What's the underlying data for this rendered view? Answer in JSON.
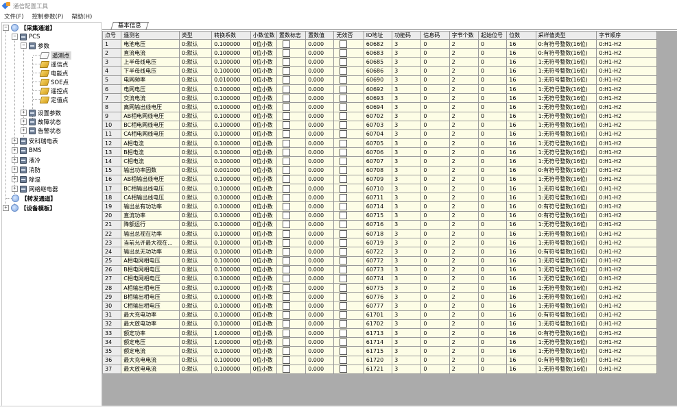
{
  "window": {
    "title": "通信配置工具"
  },
  "menu": [
    "文件(F)",
    "控制参数(P)",
    "帮助(H)"
  ],
  "tree": {
    "acq_channel": "【采集通道】",
    "pcs": "PCS",
    "params": "参数",
    "leaves": [
      "遥测点",
      "遥信点",
      "电能点",
      "SOE点",
      "遥控点",
      "定值点"
    ],
    "pcs_groups": [
      "设置参数",
      "故障状态",
      "告警状态"
    ],
    "devices": [
      "安科瑞电表",
      "BMS",
      "液冷",
      "消防",
      "除湿",
      "网络继电器"
    ],
    "fwd_channel": "【转发通道】",
    "dev_template": "【设备模板】"
  },
  "tab": {
    "label": "基本信息"
  },
  "columns": [
    "点号",
    "遥测名",
    "类型",
    "转换系数",
    "小数位数",
    "置数标志",
    "置数值",
    "无效否",
    "IO地址",
    "功能码",
    "信息码",
    "字节个数",
    "起始位号",
    "位数",
    "采样值类型",
    "字节顺序"
  ],
  "rows": [
    [
      "1",
      "电池电压",
      "0:默认",
      "0.100000",
      "0位小数",
      "",
      "0.000",
      "",
      "60682",
      "3",
      "0",
      "2",
      "0",
      "16",
      "0:有符号整数(16位)",
      "0:H1-H2"
    ],
    [
      "2",
      "直流电流",
      "0:默认",
      "0.100000",
      "0位小数",
      "",
      "0.000",
      "",
      "60683",
      "3",
      "0",
      "2",
      "0",
      "16",
      "0:有符号整数(16位)",
      "0:H1-H2"
    ],
    [
      "3",
      "上半母线电压",
      "0:默认",
      "0.100000",
      "0位小数",
      "",
      "0.000",
      "",
      "60685",
      "3",
      "0",
      "2",
      "0",
      "16",
      "1:无符号整数(16位)",
      "0:H1-H2"
    ],
    [
      "4",
      "下半母线电压",
      "0:默认",
      "0.100000",
      "0位小数",
      "",
      "0.000",
      "",
      "60686",
      "3",
      "0",
      "2",
      "0",
      "16",
      "1:无符号整数(16位)",
      "0:H1-H2"
    ],
    [
      "5",
      "电网频率",
      "0:默认",
      "0.010000",
      "0位小数",
      "",
      "0.000",
      "",
      "60690",
      "3",
      "0",
      "2",
      "0",
      "16",
      "1:无符号整数(16位)",
      "0:H1-H2"
    ],
    [
      "6",
      "电网电压",
      "0:默认",
      "0.100000",
      "0位小数",
      "",
      "0.000",
      "",
      "60692",
      "3",
      "0",
      "2",
      "0",
      "16",
      "1:无符号整数(16位)",
      "0:H1-H2"
    ],
    [
      "7",
      "交流电流",
      "0:默认",
      "0.100000",
      "0位小数",
      "",
      "0.000",
      "",
      "60693",
      "3",
      "0",
      "2",
      "0",
      "16",
      "1:无符号整数(16位)",
      "0:H1-H2"
    ],
    [
      "8",
      "离网输出线电压",
      "0:默认",
      "0.100000",
      "0位小数",
      "",
      "0.000",
      "",
      "60694",
      "3",
      "0",
      "2",
      "0",
      "16",
      "1:无符号整数(16位)",
      "0:H1-H2"
    ],
    [
      "9",
      "AB相电网线电压",
      "0:默认",
      "0.100000",
      "0位小数",
      "",
      "0.000",
      "",
      "60702",
      "3",
      "0",
      "2",
      "0",
      "16",
      "1:无符号整数(16位)",
      "0:H1-H2"
    ],
    [
      "10",
      "BC相电网线电压",
      "0:默认",
      "0.100000",
      "0位小数",
      "",
      "0.000",
      "",
      "60703",
      "3",
      "0",
      "2",
      "0",
      "16",
      "1:无符号整数(16位)",
      "0:H1-H2"
    ],
    [
      "11",
      "CA相电网线电压",
      "0:默认",
      "0.100000",
      "0位小数",
      "",
      "0.000",
      "",
      "60704",
      "3",
      "0",
      "2",
      "0",
      "16",
      "1:无符号整数(16位)",
      "0:H1-H2"
    ],
    [
      "12",
      "A相电流",
      "0:默认",
      "0.100000",
      "0位小数",
      "",
      "0.000",
      "",
      "60705",
      "3",
      "0",
      "2",
      "0",
      "16",
      "1:无符号整数(16位)",
      "0:H1-H2"
    ],
    [
      "13",
      "B相电流",
      "0:默认",
      "0.100000",
      "0位小数",
      "",
      "0.000",
      "",
      "60706",
      "3",
      "0",
      "2",
      "0",
      "16",
      "1:无符号整数(16位)",
      "0:H1-H2"
    ],
    [
      "14",
      "C相电流",
      "0:默认",
      "0.100000",
      "0位小数",
      "",
      "0.000",
      "",
      "60707",
      "3",
      "0",
      "2",
      "0",
      "16",
      "1:无符号整数(16位)",
      "0:H1-H2"
    ],
    [
      "15",
      "输出功率因数",
      "0:默认",
      "0.001000",
      "0位小数",
      "",
      "0.000",
      "",
      "60708",
      "3",
      "0",
      "2",
      "0",
      "16",
      "0:有符号整数(16位)",
      "0:H1-H2"
    ],
    [
      "16",
      "AB相输出线电压",
      "0:默认",
      "0.100000",
      "0位小数",
      "",
      "0.000",
      "",
      "60709",
      "3",
      "0",
      "2",
      "0",
      "16",
      "1:无符号整数(16位)",
      "0:H1-H2"
    ],
    [
      "17",
      "BC相输出线电压",
      "0:默认",
      "0.100000",
      "0位小数",
      "",
      "0.000",
      "",
      "60710",
      "3",
      "0",
      "2",
      "0",
      "16",
      "1:无符号整数(16位)",
      "0:H1-H2"
    ],
    [
      "18",
      "CA相输出线电压",
      "0:默认",
      "0.100000",
      "0位小数",
      "",
      "0.000",
      "",
      "60711",
      "3",
      "0",
      "2",
      "0",
      "16",
      "1:无符号整数(16位)",
      "0:H1-H2"
    ],
    [
      "19",
      "输出总有功功率",
      "0:默认",
      "0.100000",
      "0位小数",
      "",
      "0.000",
      "",
      "60714",
      "3",
      "0",
      "2",
      "0",
      "16",
      "0:有符号整数(16位)",
      "0:H1-H2"
    ],
    [
      "20",
      "直流功率",
      "0:默认",
      "0.100000",
      "0位小数",
      "",
      "0.000",
      "",
      "60715",
      "3",
      "0",
      "2",
      "0",
      "16",
      "0:有符号整数(16位)",
      "0:H1-H2"
    ],
    [
      "21",
      "降额运行",
      "0:默认",
      "0.100000",
      "0位小数",
      "",
      "0.000",
      "",
      "60716",
      "3",
      "0",
      "2",
      "0",
      "16",
      "1:无符号整数(16位)",
      "0:H1-H2"
    ],
    [
      "22",
      "输出总视在功率",
      "0:默认",
      "0.100000",
      "0位小数",
      "",
      "0.000",
      "",
      "60718",
      "3",
      "0",
      "2",
      "0",
      "16",
      "1:无符号整数(16位)",
      "0:H1-H2"
    ],
    [
      "23",
      "当前允许最大视在...",
      "0:默认",
      "0.100000",
      "0位小数",
      "",
      "0.000",
      "",
      "60719",
      "3",
      "0",
      "2",
      "0",
      "16",
      "1:无符号整数(16位)",
      "0:H1-H2"
    ],
    [
      "24",
      "输出总无功功率",
      "0:默认",
      "0.100000",
      "0位小数",
      "",
      "0.000",
      "",
      "60722",
      "3",
      "0",
      "2",
      "0",
      "16",
      "0:有符号整数(16位)",
      "0:H1-H2"
    ],
    [
      "25",
      "A相电网相电压",
      "0:默认",
      "0.100000",
      "0位小数",
      "",
      "0.000",
      "",
      "60772",
      "3",
      "0",
      "2",
      "0",
      "16",
      "1:无符号整数(16位)",
      "0:H1-H2"
    ],
    [
      "26",
      "B相电网相电压",
      "0:默认",
      "0.100000",
      "0位小数",
      "",
      "0.000",
      "",
      "60773",
      "3",
      "0",
      "2",
      "0",
      "16",
      "1:无符号整数(16位)",
      "0:H1-H2"
    ],
    [
      "27",
      "C相电网相电压",
      "0:默认",
      "0.100000",
      "0位小数",
      "",
      "0.000",
      "",
      "60774",
      "3",
      "0",
      "2",
      "0",
      "16",
      "1:无符号整数(16位)",
      "0:H1-H2"
    ],
    [
      "28",
      "A相输出相电压",
      "0:默认",
      "0.100000",
      "0位小数",
      "",
      "0.000",
      "",
      "60775",
      "3",
      "0",
      "2",
      "0",
      "16",
      "1:无符号整数(16位)",
      "0:H1-H2"
    ],
    [
      "29",
      "B相输出相电压",
      "0:默认",
      "0.100000",
      "0位小数",
      "",
      "0.000",
      "",
      "60776",
      "3",
      "0",
      "2",
      "0",
      "16",
      "1:无符号整数(16位)",
      "0:H1-H2"
    ],
    [
      "30",
      "C相输出相电压",
      "0:默认",
      "0.100000",
      "0位小数",
      "",
      "0.000",
      "",
      "60777",
      "3",
      "0",
      "2",
      "0",
      "16",
      "1:无符号整数(16位)",
      "0:H1-H2"
    ],
    [
      "31",
      "最大充电功率",
      "0:默认",
      "0.100000",
      "0位小数",
      "",
      "0.000",
      "",
      "61701",
      "3",
      "0",
      "2",
      "0",
      "16",
      "0:有符号整数(16位)",
      "0:H1-H2"
    ],
    [
      "32",
      "最大放电功率",
      "0:默认",
      "0.100000",
      "0位小数",
      "",
      "0.000",
      "",
      "61702",
      "3",
      "0",
      "2",
      "0",
      "16",
      "1:无符号整数(16位)",
      "0:H1-H2"
    ],
    [
      "33",
      "额定功率",
      "0:默认",
      "1.000000",
      "0位小数",
      "",
      "0.000",
      "",
      "61713",
      "3",
      "0",
      "2",
      "0",
      "16",
      "0:有符号整数(16位)",
      "0:H1-H2"
    ],
    [
      "34",
      "额定电压",
      "0:默认",
      "1.000000",
      "0位小数",
      "",
      "0.000",
      "",
      "61714",
      "3",
      "0",
      "2",
      "0",
      "16",
      "1:无符号整数(16位)",
      "0:H1-H2"
    ],
    [
      "35",
      "额定电流",
      "0:默认",
      "0.100000",
      "0位小数",
      "",
      "0.000",
      "",
      "61715",
      "3",
      "0",
      "2",
      "0",
      "16",
      "1:无符号整数(16位)",
      "0:H1-H2"
    ],
    [
      "36",
      "最大充电电流",
      "0:默认",
      "0.100000",
      "0位小数",
      "",
      "0.000",
      "",
      "61720",
      "3",
      "0",
      "2",
      "0",
      "16",
      "0:有符号整数(16位)",
      "0:H1-H2"
    ],
    [
      "37",
      "最大放电电流",
      "0:默认",
      "0.100000",
      "0位小数",
      "",
      "0.000",
      "",
      "61721",
      "3",
      "0",
      "2",
      "0",
      "16",
      "1:无符号整数(16位)",
      "0:H1-H2"
    ]
  ]
}
